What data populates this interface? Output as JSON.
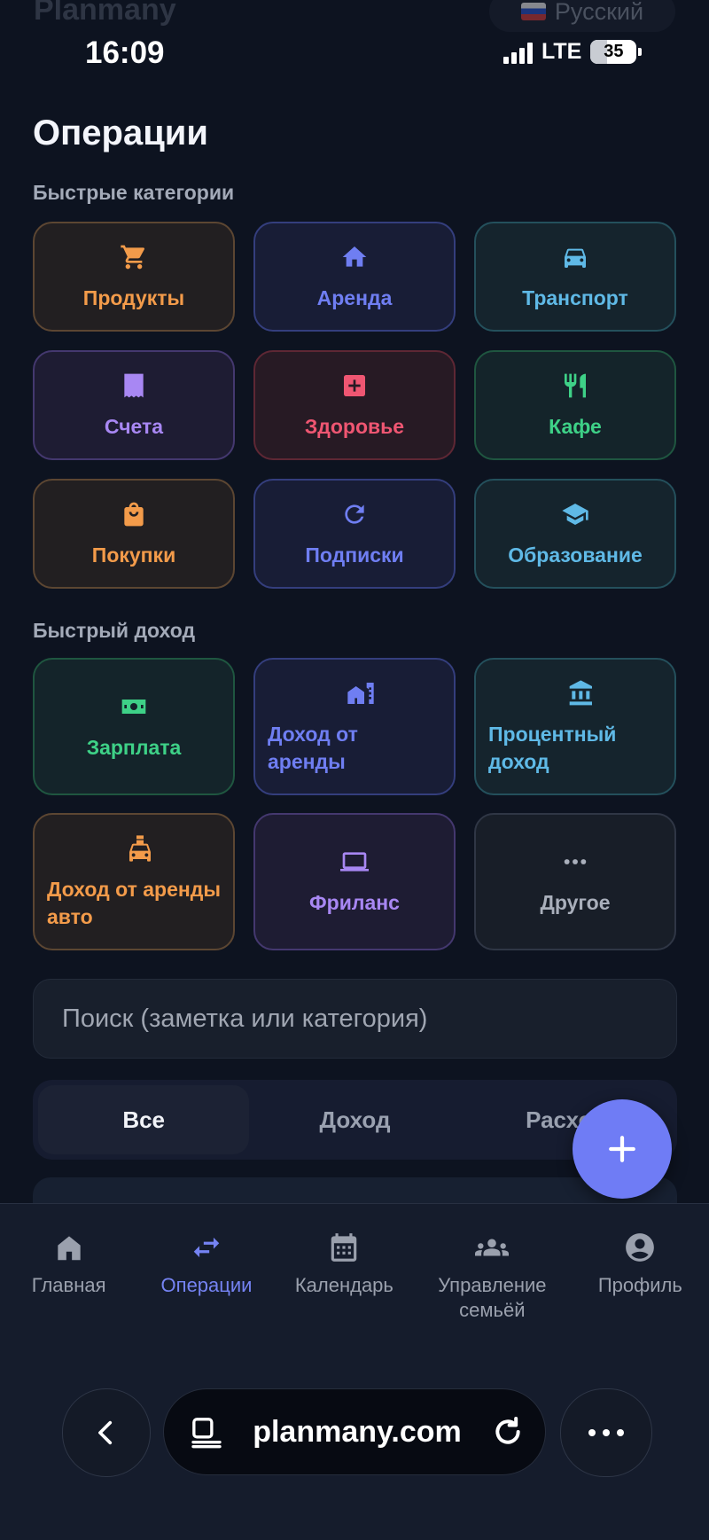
{
  "app": {
    "brand": "Planmany",
    "language": "Русский"
  },
  "status": {
    "time": "16:09",
    "network": "LTE",
    "battery": "35",
    "battery_level": 0.35
  },
  "page": {
    "title": "Операции"
  },
  "quick_categories": {
    "label": "Быстрые категории",
    "items": [
      {
        "label": "Продукты",
        "icon": "cart-icon",
        "color": "#f39b4a"
      },
      {
        "label": "Аренда",
        "icon": "home-icon",
        "color": "#6f7ef2"
      },
      {
        "label": "Транспорт",
        "icon": "car-icon",
        "color": "#5fb9e6"
      },
      {
        "label": "Счета",
        "icon": "receipt-icon",
        "color": "#a887f3"
      },
      {
        "label": "Здоровье",
        "icon": "medical-icon",
        "color": "#ef5672"
      },
      {
        "label": "Кафе",
        "icon": "restaurant-icon",
        "color": "#3ed187"
      },
      {
        "label": "Покупки",
        "icon": "shopping-bag-icon",
        "color": "#f39b4a"
      },
      {
        "label": "Подписки",
        "icon": "refresh-icon",
        "color": "#6f7ef2"
      },
      {
        "label": "Образование",
        "icon": "graduation-cap-icon",
        "color": "#5fb9e6"
      }
    ]
  },
  "quick_income": {
    "label": "Быстрый доход",
    "items": [
      {
        "label": "Зарплата",
        "icon": "money-icon",
        "color": "#3ed187"
      },
      {
        "label": "Доход от аренды",
        "icon": "buildings-icon",
        "color": "#6f7ef2"
      },
      {
        "label": "Процентный доход",
        "icon": "bank-icon",
        "color": "#5fb9e6"
      },
      {
        "label": "Доход от аренды авто",
        "icon": "taxi-icon",
        "color": "#f39b4a"
      },
      {
        "label": "Фриланс",
        "icon": "laptop-icon",
        "color": "#a887f3"
      },
      {
        "label": "Другое",
        "icon": "more-icon",
        "color": "#a9afbb"
      }
    ]
  },
  "search": {
    "placeholder": "Поиск (заметка или категория)",
    "value": ""
  },
  "filter": {
    "options": [
      "Все",
      "Доход",
      "Расход"
    ],
    "selected": "Все"
  },
  "bottom_nav": [
    {
      "label": "Главная",
      "icon": "home-icon"
    },
    {
      "label": "Операции",
      "icon": "swap-icon",
      "active": true
    },
    {
      "label": "Календарь",
      "icon": "calendar-icon"
    },
    {
      "label": "Управление семьёй",
      "icon": "group-icon"
    },
    {
      "label": "Профиль",
      "icon": "profile-icon"
    }
  ],
  "browser": {
    "url": "planmany.com"
  }
}
